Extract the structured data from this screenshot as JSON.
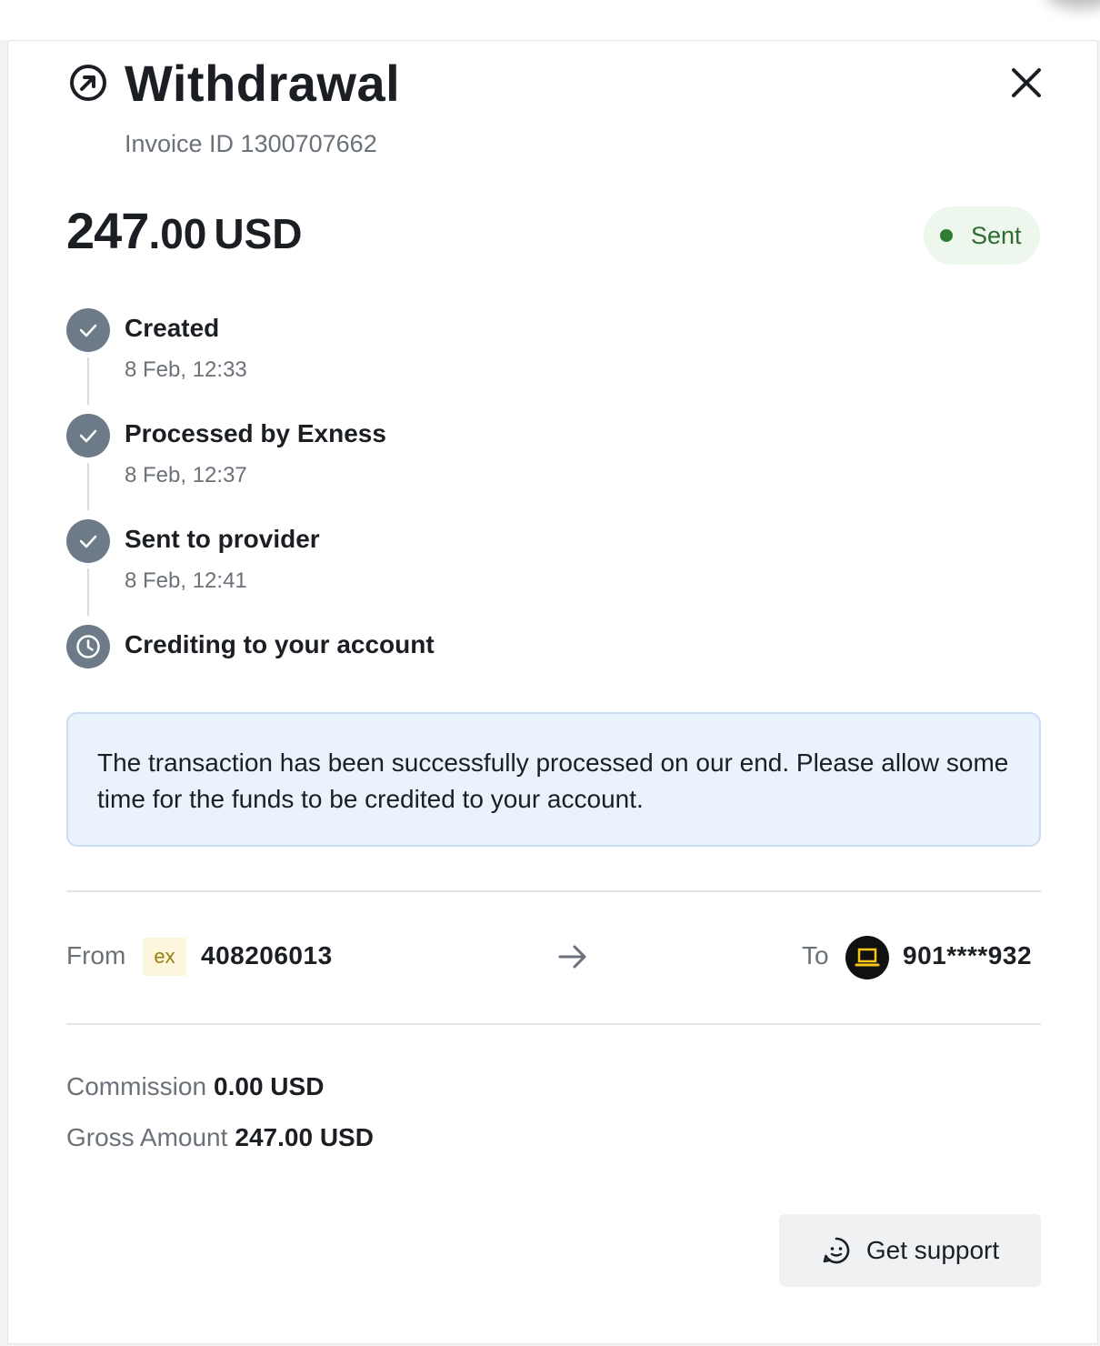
{
  "header": {
    "title": "Withdrawal",
    "invoice": "Invoice ID 1300707662"
  },
  "amount": {
    "integer": "247",
    "decimals": ".00",
    "currency": "USD"
  },
  "status": {
    "label": "Sent",
    "color": "#2f7d32"
  },
  "steps": [
    {
      "label": "Created",
      "time": "8 Feb, 12:33",
      "icon": "check-icon"
    },
    {
      "label": "Processed by Exness",
      "time": "8 Feb, 12:37",
      "icon": "check-icon"
    },
    {
      "label": "Sent to provider",
      "time": "8 Feb, 12:41",
      "icon": "check-icon"
    },
    {
      "label": "Crediting to your account",
      "icon": "clock-icon"
    }
  ],
  "info": "The transaction has been successfully processed on our end. Please allow some time for the funds to be credited to your account.",
  "transfer": {
    "from_label": "From",
    "from_logo": "ex",
    "from_account": "408206013",
    "to_label": "To",
    "to_account": "901****932"
  },
  "fees": {
    "commission_label": "Commission",
    "commission_value": "0.00 USD",
    "gross_label": "Gross Amount",
    "gross_value": "247.00 USD"
  },
  "support_button": "Get support"
}
